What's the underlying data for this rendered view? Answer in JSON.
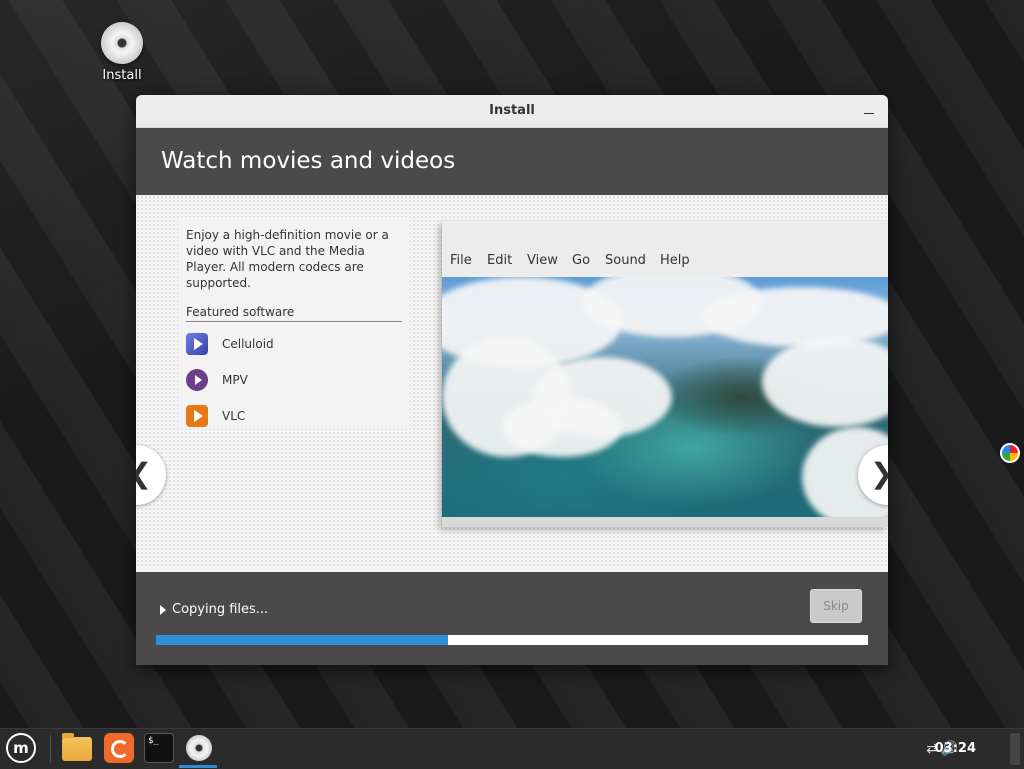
{
  "desktop": {
    "icon_label": "Install"
  },
  "window": {
    "title": "Install",
    "header": "Watch movies and videos",
    "slide": {
      "description": "Enjoy a high-definition movie or a video with VLC and the Media Player. All modern codecs are supported.",
      "featured_label": "Featured software",
      "software": [
        "Celluloid",
        "MPV",
        "VLC"
      ],
      "screenshot_menu": [
        "File",
        "Edit",
        "View",
        "Go",
        "Sound",
        "Help"
      ],
      "prev_glyph": "❮",
      "next_glyph": "❯"
    },
    "footer": {
      "status": "Copying files...",
      "skip_label": "Skip",
      "progress_percent": 41
    }
  },
  "taskbar": {
    "clock": "03:24",
    "terminal_glyph": "$_"
  },
  "colors": {
    "progress": "#2f8fd6",
    "header": "#4a4a4a"
  }
}
